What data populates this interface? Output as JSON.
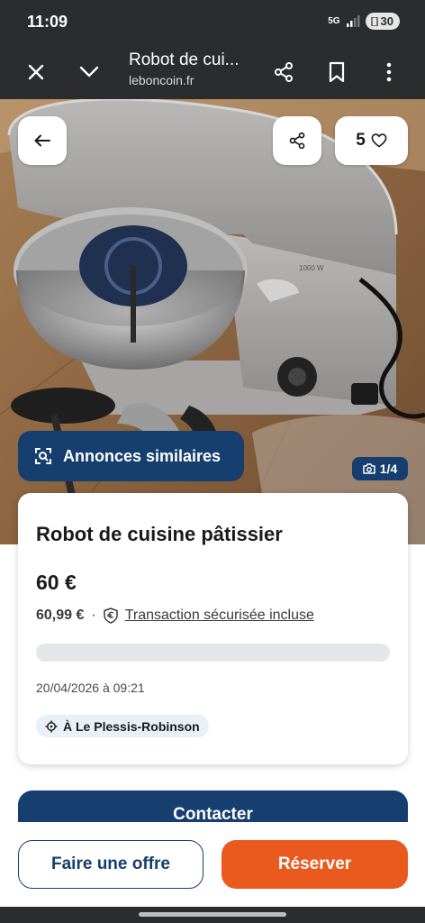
{
  "status": {
    "time": "11:09",
    "network": "5G",
    "battery": "30"
  },
  "browser": {
    "title": "Robot de cui...",
    "domain": "leboncoin.fr",
    "icons": [
      "close-icon",
      "chevron-down-icon",
      "share-icon",
      "bookmark-icon",
      "more-vert-icon"
    ]
  },
  "gallery": {
    "favorites_count": "5",
    "similar_label": "Annonces similaires",
    "photo_counter": "1/4",
    "appliance_badge": "1000 W"
  },
  "listing": {
    "title": "Robot de cuisine pâtissier",
    "price": "60 €",
    "price_with_fees": "60,99 €",
    "separator": "·",
    "secure_label": "Transaction sécurisée incluse",
    "date": "20/04/2026 à 09:21",
    "location": "À Le Plessis-Robinson"
  },
  "actions": {
    "contact": "Contacter",
    "offer": "Faire une offre",
    "reserve": "Réserver"
  },
  "colors": {
    "brand_blue": "#163e6e",
    "reserve_orange": "#ea5a1e",
    "system_bar": "#2b2c2e"
  }
}
